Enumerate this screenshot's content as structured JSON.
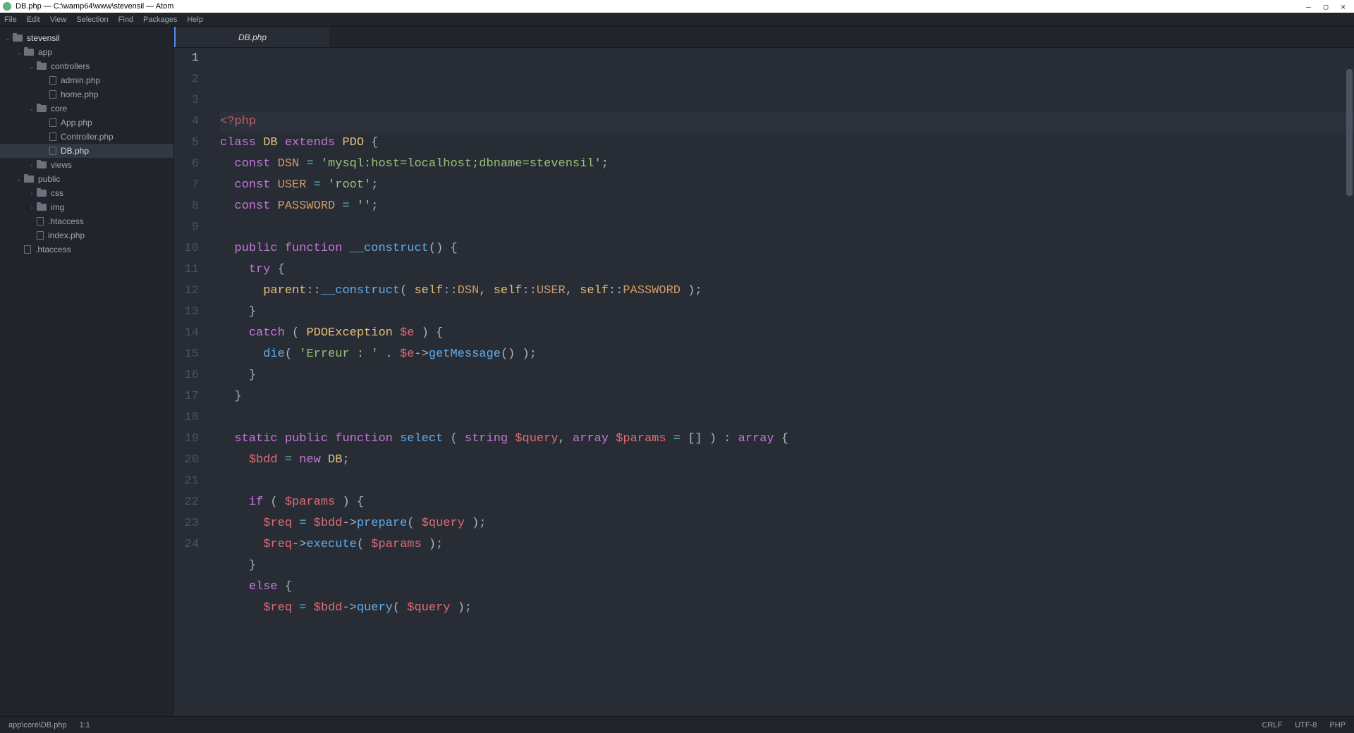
{
  "window": {
    "title": "DB.php — C:\\wamp64\\www\\stevensil — Atom"
  },
  "menu": [
    "File",
    "Edit",
    "View",
    "Selection",
    "Find",
    "Packages",
    "Help"
  ],
  "tree": [
    {
      "depth": 0,
      "type": "folder",
      "icon": "folder",
      "chev": "down",
      "label": "stevensil",
      "root": true,
      "name": "tree-root-stevensil"
    },
    {
      "depth": 1,
      "type": "folder",
      "icon": "folder",
      "chev": "down",
      "label": "app",
      "name": "tree-folder-app"
    },
    {
      "depth": 2,
      "type": "folder",
      "icon": "folder",
      "chev": "down",
      "label": "controllers",
      "name": "tree-folder-controllers"
    },
    {
      "depth": 3,
      "type": "file",
      "icon": "file",
      "chev": "",
      "label": "admin.php",
      "name": "tree-file-admin-php"
    },
    {
      "depth": 3,
      "type": "file",
      "icon": "file",
      "chev": "",
      "label": "home.php",
      "name": "tree-file-home-php"
    },
    {
      "depth": 2,
      "type": "folder",
      "icon": "folder",
      "chev": "down",
      "label": "core",
      "name": "tree-folder-core"
    },
    {
      "depth": 3,
      "type": "file",
      "icon": "file",
      "chev": "",
      "label": "App.php",
      "name": "tree-file-app-php"
    },
    {
      "depth": 3,
      "type": "file",
      "icon": "file",
      "chev": "",
      "label": "Controller.php",
      "name": "tree-file-controller-php"
    },
    {
      "depth": 3,
      "type": "file",
      "icon": "file",
      "chev": "",
      "label": "DB.php",
      "selected": true,
      "name": "tree-file-db-php"
    },
    {
      "depth": 2,
      "type": "folder",
      "icon": "folder",
      "chev": "right",
      "label": "views",
      "name": "tree-folder-views"
    },
    {
      "depth": 1,
      "type": "folder",
      "icon": "folder",
      "chev": "down",
      "label": "public",
      "name": "tree-folder-public"
    },
    {
      "depth": 2,
      "type": "folder",
      "icon": "folder",
      "chev": "right",
      "label": "css",
      "name": "tree-folder-css"
    },
    {
      "depth": 2,
      "type": "folder",
      "icon": "folder",
      "chev": "right",
      "label": "img",
      "name": "tree-folder-img"
    },
    {
      "depth": 2,
      "type": "file",
      "icon": "file",
      "chev": "",
      "label": ".htaccess",
      "name": "tree-file-htaccess-public"
    },
    {
      "depth": 2,
      "type": "file",
      "icon": "file",
      "chev": "",
      "label": "index.php",
      "name": "tree-file-index-php"
    },
    {
      "depth": 1,
      "type": "file",
      "icon": "file",
      "chev": "",
      "label": ".htaccess",
      "name": "tree-file-htaccess-root"
    }
  ],
  "tab": {
    "label": "DB.php"
  },
  "code": {
    "lines": [
      {
        "n": 1,
        "current": true,
        "segs": [
          [
            "<?php",
            "c-tag"
          ]
        ]
      },
      {
        "n": 2,
        "segs": [
          [
            "class ",
            "c-key"
          ],
          [
            "DB ",
            "c-class"
          ],
          [
            "extends ",
            "c-key"
          ],
          [
            "PDO ",
            "c-class"
          ],
          [
            "{",
            "c-punc"
          ]
        ]
      },
      {
        "n": 3,
        "segs": [
          [
            "  ",
            ""
          ],
          [
            "const ",
            "c-key"
          ],
          [
            "DSN ",
            "c-const"
          ],
          [
            "= ",
            "c-op"
          ],
          [
            "'mysql:host=localhost;dbname=stevensil'",
            "c-str"
          ],
          [
            ";",
            "c-punc"
          ]
        ]
      },
      {
        "n": 4,
        "segs": [
          [
            "  ",
            ""
          ],
          [
            "const ",
            "c-key"
          ],
          [
            "USER ",
            "c-const"
          ],
          [
            "= ",
            "c-op"
          ],
          [
            "'root'",
            "c-str"
          ],
          [
            ";",
            "c-punc"
          ]
        ]
      },
      {
        "n": 5,
        "segs": [
          [
            "  ",
            ""
          ],
          [
            "const ",
            "c-key"
          ],
          [
            "PASSWORD ",
            "c-const"
          ],
          [
            "= ",
            "c-op"
          ],
          [
            "''",
            "c-str"
          ],
          [
            ";",
            "c-punc"
          ]
        ]
      },
      {
        "n": 6,
        "segs": [
          [
            "",
            ""
          ]
        ]
      },
      {
        "n": 7,
        "segs": [
          [
            "  ",
            ""
          ],
          [
            "public ",
            "c-key"
          ],
          [
            "function ",
            "c-key"
          ],
          [
            "__construct",
            "c-func"
          ],
          [
            "() {",
            "c-punc"
          ]
        ]
      },
      {
        "n": 8,
        "segs": [
          [
            "    ",
            ""
          ],
          [
            "try ",
            "c-key"
          ],
          [
            "{",
            "c-punc"
          ]
        ]
      },
      {
        "n": 9,
        "segs": [
          [
            "      ",
            ""
          ],
          [
            "parent",
            "c-self"
          ],
          [
            "::",
            "c-punc"
          ],
          [
            "__construct",
            "c-func"
          ],
          [
            "( ",
            "c-punc"
          ],
          [
            "self",
            "c-self"
          ],
          [
            "::",
            "c-punc"
          ],
          [
            "DSN",
            "c-const"
          ],
          [
            ", ",
            "c-punc"
          ],
          [
            "self",
            "c-self"
          ],
          [
            "::",
            "c-punc"
          ],
          [
            "USER",
            "c-const"
          ],
          [
            ", ",
            "c-punc"
          ],
          [
            "self",
            "c-self"
          ],
          [
            "::",
            "c-punc"
          ],
          [
            "PASSWORD",
            "c-const"
          ],
          [
            " );",
            "c-punc"
          ]
        ]
      },
      {
        "n": 10,
        "segs": [
          [
            "    }",
            "c-punc"
          ]
        ]
      },
      {
        "n": 11,
        "segs": [
          [
            "    ",
            ""
          ],
          [
            "catch ",
            "c-key"
          ],
          [
            "( ",
            "c-punc"
          ],
          [
            "PDOException ",
            "c-class"
          ],
          [
            "$e",
            "c-var"
          ],
          [
            " ) {",
            "c-punc"
          ]
        ]
      },
      {
        "n": 12,
        "segs": [
          [
            "      ",
            ""
          ],
          [
            "die",
            "c-func"
          ],
          [
            "( ",
            "c-punc"
          ],
          [
            "'Erreur : '",
            "c-str"
          ],
          [
            " . ",
            "c-punc"
          ],
          [
            "$e",
            "c-var"
          ],
          [
            "->",
            "c-punc"
          ],
          [
            "getMessage",
            "c-func"
          ],
          [
            "() );",
            "c-punc"
          ]
        ]
      },
      {
        "n": 13,
        "segs": [
          [
            "    }",
            "c-punc"
          ]
        ]
      },
      {
        "n": 14,
        "segs": [
          [
            "  }",
            "c-punc"
          ]
        ]
      },
      {
        "n": 15,
        "segs": [
          [
            "",
            ""
          ]
        ]
      },
      {
        "n": 16,
        "segs": [
          [
            "  ",
            ""
          ],
          [
            "static ",
            "c-key"
          ],
          [
            "public ",
            "c-key"
          ],
          [
            "function ",
            "c-key"
          ],
          [
            "select ",
            "c-func"
          ],
          [
            "( ",
            "c-punc"
          ],
          [
            "string ",
            "c-key"
          ],
          [
            "$query",
            "c-var"
          ],
          [
            ", ",
            "c-punc"
          ],
          [
            "array ",
            "c-key"
          ],
          [
            "$params",
            "c-var"
          ],
          [
            " = ",
            "c-op"
          ],
          [
            "[] ) : ",
            "c-punc"
          ],
          [
            "array ",
            "c-key"
          ],
          [
            "{",
            "c-punc"
          ]
        ]
      },
      {
        "n": 17,
        "segs": [
          [
            "    ",
            ""
          ],
          [
            "$bdd",
            "c-var"
          ],
          [
            " = ",
            "c-op"
          ],
          [
            "new ",
            "c-key"
          ],
          [
            "DB",
            "c-class"
          ],
          [
            ";",
            "c-punc"
          ]
        ]
      },
      {
        "n": 18,
        "segs": [
          [
            "",
            ""
          ]
        ]
      },
      {
        "n": 19,
        "segs": [
          [
            "    ",
            ""
          ],
          [
            "if ",
            "c-key"
          ],
          [
            "( ",
            "c-punc"
          ],
          [
            "$params",
            "c-var"
          ],
          [
            " ) {",
            "c-punc"
          ]
        ]
      },
      {
        "n": 20,
        "segs": [
          [
            "      ",
            ""
          ],
          [
            "$req",
            "c-var"
          ],
          [
            " = ",
            "c-op"
          ],
          [
            "$bdd",
            "c-var"
          ],
          [
            "->",
            "c-punc"
          ],
          [
            "prepare",
            "c-func"
          ],
          [
            "( ",
            "c-punc"
          ],
          [
            "$query",
            "c-var"
          ],
          [
            " );",
            "c-punc"
          ]
        ]
      },
      {
        "n": 21,
        "segs": [
          [
            "      ",
            ""
          ],
          [
            "$req",
            "c-var"
          ],
          [
            "->",
            "c-punc"
          ],
          [
            "execute",
            "c-func"
          ],
          [
            "( ",
            "c-punc"
          ],
          [
            "$params",
            "c-var"
          ],
          [
            " );",
            "c-punc"
          ]
        ]
      },
      {
        "n": 22,
        "segs": [
          [
            "    }",
            "c-punc"
          ]
        ]
      },
      {
        "n": 23,
        "segs": [
          [
            "    ",
            ""
          ],
          [
            "else ",
            "c-key"
          ],
          [
            "{",
            "c-punc"
          ]
        ]
      },
      {
        "n": 24,
        "segs": [
          [
            "      ",
            ""
          ],
          [
            "$req",
            "c-var"
          ],
          [
            " = ",
            "c-op"
          ],
          [
            "$bdd",
            "c-var"
          ],
          [
            "->",
            "c-punc"
          ],
          [
            "query",
            "c-func"
          ],
          [
            "( ",
            "c-punc"
          ],
          [
            "$query",
            "c-var"
          ],
          [
            " );",
            "c-punc"
          ]
        ]
      }
    ]
  },
  "status": {
    "path": "app\\core\\DB.php",
    "cursor": "1:1",
    "eol": "CRLF",
    "encoding": "UTF-8",
    "lang": "PHP"
  }
}
